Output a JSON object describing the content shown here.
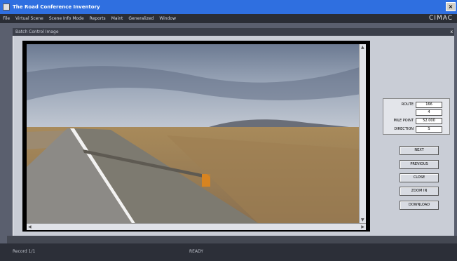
{
  "window": {
    "title": "The Road Conference Inventory",
    "close_label": "×"
  },
  "menubar": {
    "items": [
      "File",
      "Virtual Scene",
      "Scene Info Mode",
      "Reports",
      "Maint",
      "Generalized",
      "Window"
    ],
    "brand": "CIMAC"
  },
  "panel": {
    "title": "Batch Control Image",
    "close_label": "x"
  },
  "controls": {
    "fields": [
      {
        "label": "ROUTE",
        "value": "166"
      },
      {
        "label": "",
        "value": "4"
      },
      {
        "label": "MILE POINT",
        "value": "52.000"
      },
      {
        "label": "DIRECTION",
        "value": "S"
      }
    ]
  },
  "buttons": {
    "next": "NEXT",
    "previous": "PREVIOUS",
    "close": "CLOSE",
    "zoom": "ZOOM IN",
    "download": "DOWNLOAD"
  },
  "status": {
    "left": "Record 1/1",
    "center": "READY"
  },
  "colors": {
    "titlebar": "#2f6fe0",
    "menubar": "#2a2d35",
    "panel_body": "#c9cdd6"
  }
}
